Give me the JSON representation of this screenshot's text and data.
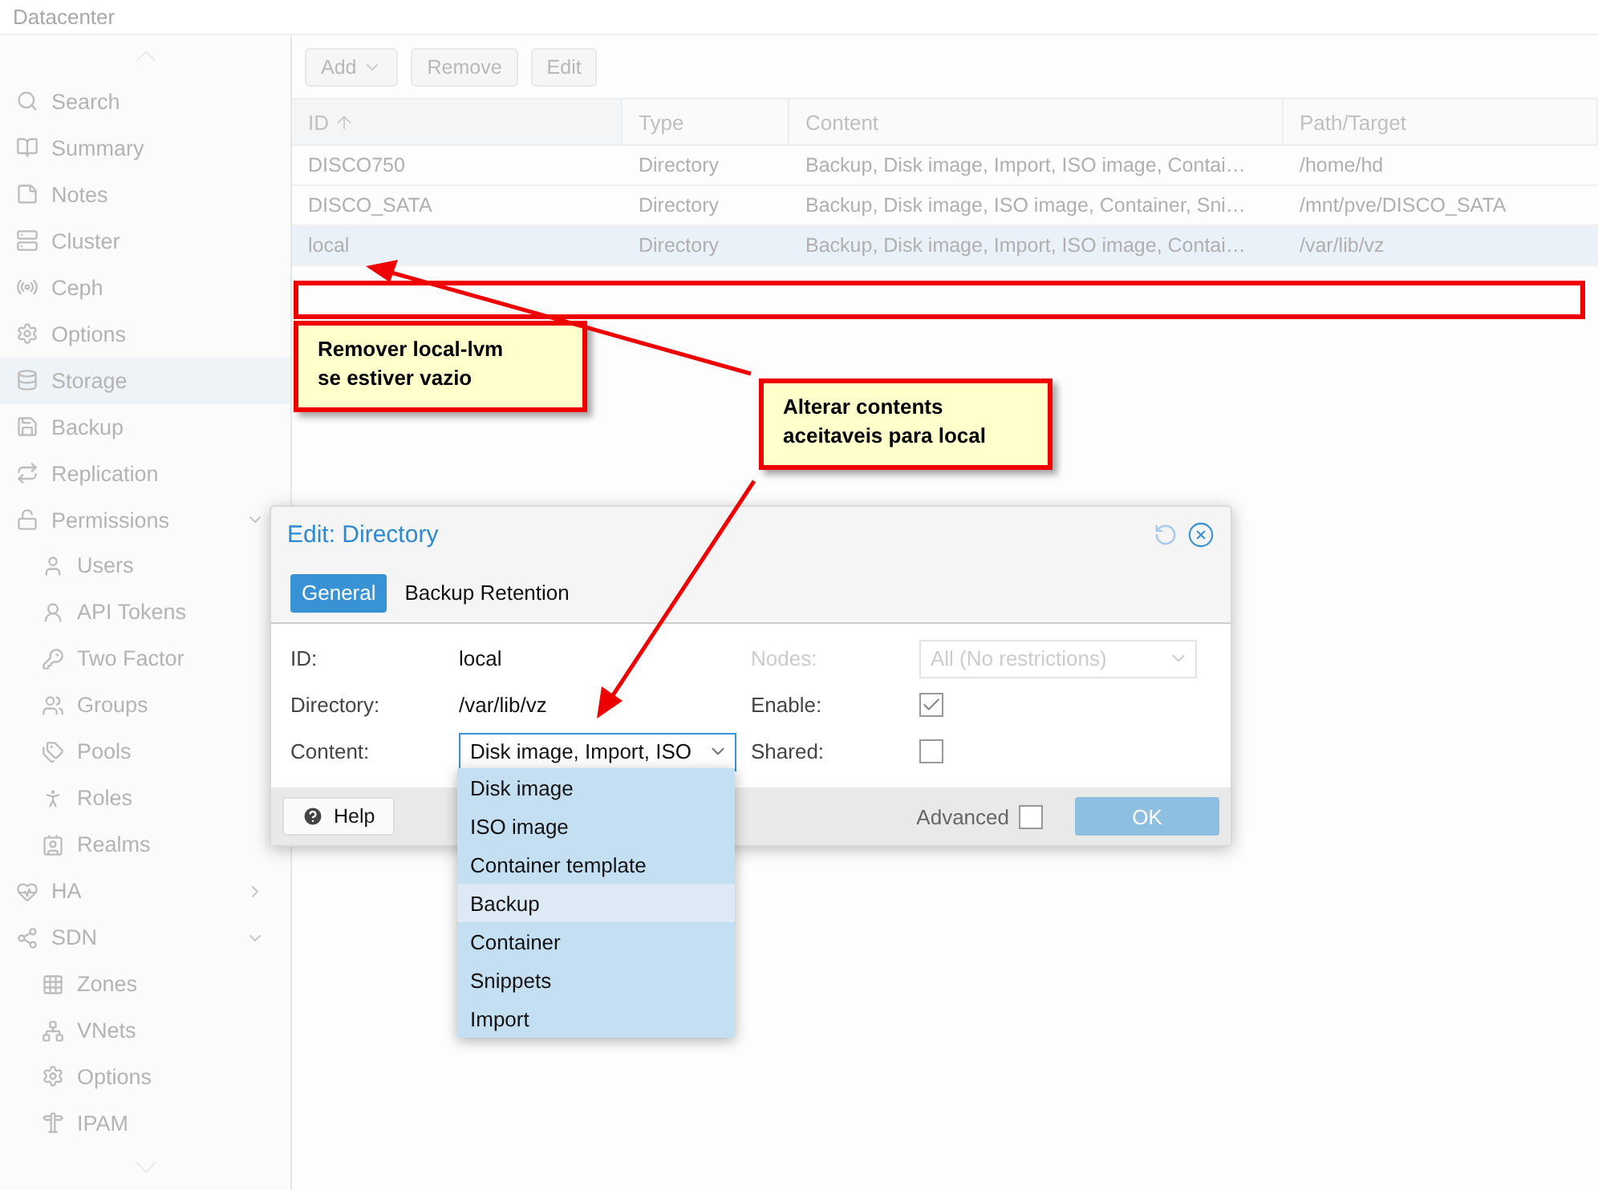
{
  "header": {
    "title": "Datacenter"
  },
  "sidebar": {
    "items": [
      {
        "label": "Search",
        "selected": false
      },
      {
        "label": "Summary",
        "selected": false
      },
      {
        "label": "Notes",
        "selected": false
      },
      {
        "label": "Cluster",
        "selected": false
      },
      {
        "label": "Ceph",
        "selected": false
      },
      {
        "label": "Options",
        "selected": false
      },
      {
        "label": "Storage",
        "selected": true
      },
      {
        "label": "Backup",
        "selected": false
      },
      {
        "label": "Replication",
        "selected": false
      },
      {
        "label": "Permissions",
        "selected": false,
        "expanded": true,
        "children": [
          {
            "label": "Users",
            "selected": false
          },
          {
            "label": "API Tokens",
            "selected": false
          },
          {
            "label": "Two Factor",
            "selected": false
          },
          {
            "label": "Groups",
            "selected": false
          },
          {
            "label": "Pools",
            "selected": false
          },
          {
            "label": "Roles",
            "selected": false
          },
          {
            "label": "Realms",
            "selected": false
          }
        ]
      },
      {
        "label": "HA",
        "selected": false,
        "expanded": false
      },
      {
        "label": "SDN",
        "selected": false,
        "expanded": true,
        "children": [
          {
            "label": "Zones",
            "selected": false
          },
          {
            "label": "VNets",
            "selected": false
          },
          {
            "label": "Options",
            "selected": false
          },
          {
            "label": "IPAM",
            "selected": false
          }
        ]
      }
    ]
  },
  "toolbar": {
    "buttons": [
      {
        "label": "Add",
        "kind": "menu"
      },
      {
        "label": "Remove",
        "kind": "plain"
      },
      {
        "label": "Edit",
        "kind": "plain"
      }
    ]
  },
  "table": {
    "columns": [
      {
        "label": "ID",
        "sorted": true
      },
      {
        "label": "Type",
        "sorted": false
      },
      {
        "label": "Content",
        "sorted": false
      },
      {
        "label": "Path/Target",
        "sorted": false
      }
    ],
    "rows": [
      {
        "cells": [
          "DISCO750",
          "Directory",
          "Backup, Disk image, Import, ISO image, Contai…",
          "/home/hd"
        ],
        "selected": false
      },
      {
        "cells": [
          "DISCO_SATA",
          "Directory",
          "Backup, Disk image, ISO image, Container, Sni…",
          "/mnt/pve/DISCO_SATA"
        ],
        "selected": false
      },
      {
        "cells": [
          "local",
          "Directory",
          "Backup, Disk image, Import, ISO image, Contai…",
          "/var/lib/vz"
        ],
        "selected": true
      }
    ]
  },
  "dialog": {
    "title": "Edit: Directory",
    "tabs": [
      {
        "label": "General",
        "selected": true
      },
      {
        "label": "Backup Retention",
        "selected": false
      }
    ],
    "left_fields": [
      {
        "label": "ID:",
        "kind": "text",
        "value": "local"
      },
      {
        "label": "Directory:",
        "kind": "text",
        "value": "/var/lib/vz"
      },
      {
        "label": "Content:",
        "kind": "select",
        "value": "Disk image, Import, ISO"
      }
    ],
    "right_fields": [
      {
        "label": "Nodes:",
        "kind": "select",
        "value": "All (No restrictions)",
        "disabled": true
      },
      {
        "label": "Enable:",
        "kind": "checkbox",
        "checked": true,
        "disabled": false
      },
      {
        "label": "Shared:",
        "kind": "checkbox",
        "checked": false,
        "disabled": false
      }
    ],
    "help": "Help",
    "advanced": {
      "label": "Advanced",
      "checked": false
    },
    "ok": {
      "label": "OK",
      "disabled": true
    }
  },
  "content_options": [
    {
      "label": "Disk image",
      "selected": true
    },
    {
      "label": "ISO image",
      "selected": true
    },
    {
      "label": "Container template",
      "selected": true
    },
    {
      "label": "Backup",
      "selected": false
    },
    {
      "label": "Container",
      "selected": true
    },
    {
      "label": "Snippets",
      "selected": true
    },
    {
      "label": "Import",
      "selected": true
    }
  ],
  "annotations": [
    {
      "text": "Remover local-lvm\nse estiver vazio"
    },
    {
      "text": "Alterar contents\naceitaveis para local"
    }
  ]
}
